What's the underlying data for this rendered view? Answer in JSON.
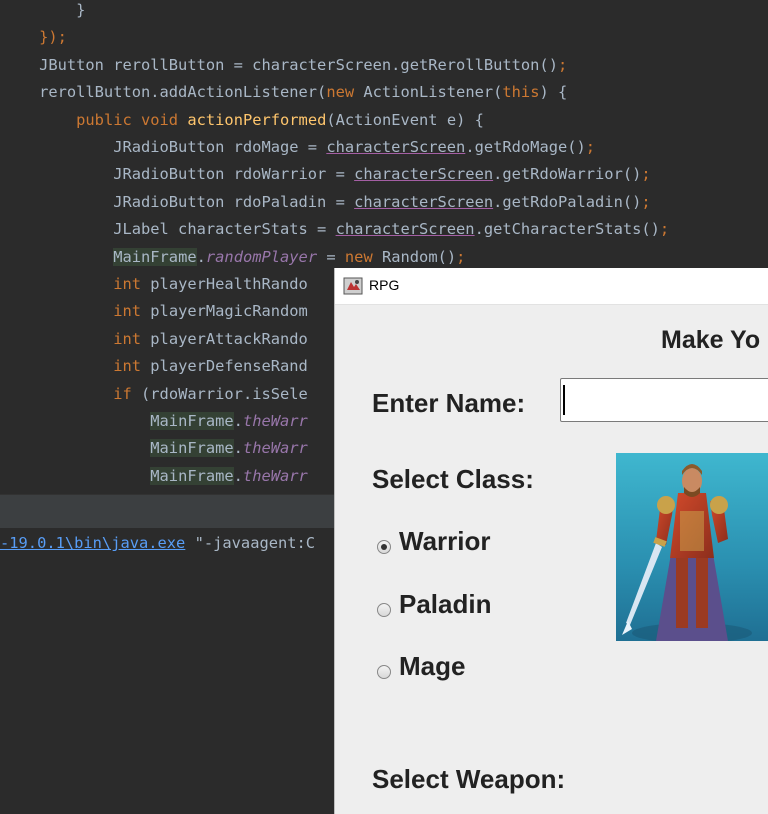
{
  "editor": {
    "lines": [
      {
        "parts": [
          {
            "t": "        }",
            "c": ""
          }
        ]
      },
      {
        "parts": [
          {
            "t": "    });",
            "c": "kw-semi"
          }
        ]
      },
      {
        "parts": [
          {
            "t": "    JButton rerollButton = characterScreen.getRerollButton()",
            "c": ""
          },
          {
            "t": ";",
            "c": "kw"
          }
        ]
      },
      {
        "parts": [
          {
            "t": "    rerollButton.addActionListener(",
            "c": ""
          },
          {
            "t": "new",
            "c": "kw"
          },
          {
            "t": " ActionListener(",
            "c": ""
          },
          {
            "t": "this",
            "c": "kw"
          },
          {
            "t": ") {",
            "c": ""
          }
        ]
      },
      {
        "parts": [
          {
            "t": "        ",
            "c": ""
          },
          {
            "t": "public void",
            "c": "kw"
          },
          {
            "t": " ",
            "c": ""
          },
          {
            "t": "actionPerformed",
            "c": "fn"
          },
          {
            "t": "(ActionEvent e) {",
            "c": ""
          }
        ]
      },
      {
        "parts": [
          {
            "t": "            JRadioButton rdoMage = ",
            "c": ""
          },
          {
            "t": "characterScreen",
            "c": "ul"
          },
          {
            "t": ".getRdoMage()",
            "c": ""
          },
          {
            "t": ";",
            "c": "kw"
          }
        ]
      },
      {
        "parts": [
          {
            "t": "            JRadioButton rdoWarrior = ",
            "c": ""
          },
          {
            "t": "characterScreen",
            "c": "ul"
          },
          {
            "t": ".getRdoWarrior()",
            "c": ""
          },
          {
            "t": ";",
            "c": "kw"
          }
        ]
      },
      {
        "parts": [
          {
            "t": "            JRadioButton rdoPaladin = ",
            "c": ""
          },
          {
            "t": "characterScreen",
            "c": "ul"
          },
          {
            "t": ".getRdoPaladin()",
            "c": ""
          },
          {
            "t": ";",
            "c": "kw"
          }
        ]
      },
      {
        "parts": [
          {
            "t": "            JLabel characterStats = ",
            "c": ""
          },
          {
            "t": "characterScreen",
            "c": "ul"
          },
          {
            "t": ".getCharacterStats()",
            "c": ""
          },
          {
            "t": ";",
            "c": "kw"
          }
        ]
      },
      {
        "parts": [
          {
            "t": "            ",
            "c": ""
          },
          {
            "t": "MainFrame",
            "c": "hl"
          },
          {
            "t": ".",
            "c": ""
          },
          {
            "t": "randomPlayer",
            "c": "fld"
          },
          {
            "t": " = ",
            "c": ""
          },
          {
            "t": "new",
            "c": "kw"
          },
          {
            "t": " Random()",
            "c": ""
          },
          {
            "t": ";",
            "c": "kw"
          }
        ]
      },
      {
        "parts": [
          {
            "t": "            ",
            "c": ""
          },
          {
            "t": "int",
            "c": "kw"
          },
          {
            "t": " playerHealthRando",
            "c": ""
          }
        ]
      },
      {
        "parts": [
          {
            "t": "            ",
            "c": ""
          },
          {
            "t": "int",
            "c": "kw"
          },
          {
            "t": " playerMagicRandom",
            "c": ""
          }
        ]
      },
      {
        "parts": [
          {
            "t": "            ",
            "c": ""
          },
          {
            "t": "int",
            "c": "kw"
          },
          {
            "t": " playerAttackRando",
            "c": ""
          }
        ]
      },
      {
        "parts": [
          {
            "t": "            ",
            "c": ""
          },
          {
            "t": "int",
            "c": "kw"
          },
          {
            "t": " playerDefenseRand",
            "c": ""
          }
        ]
      },
      {
        "parts": [
          {
            "t": "            ",
            "c": ""
          },
          {
            "t": "if",
            "c": "kw"
          },
          {
            "t": " (rdoWarrior.isSele",
            "c": ""
          }
        ]
      },
      {
        "parts": [
          {
            "t": "                ",
            "c": ""
          },
          {
            "t": "MainFrame",
            "c": "hl"
          },
          {
            "t": ".",
            "c": ""
          },
          {
            "t": "theWarr",
            "c": "fld"
          }
        ]
      },
      {
        "parts": [
          {
            "t": "                ",
            "c": ""
          },
          {
            "t": "MainFrame",
            "c": "hl"
          },
          {
            "t": ".",
            "c": ""
          },
          {
            "t": "theWarr",
            "c": "fld"
          }
        ]
      },
      {
        "parts": [
          {
            "t": "                ",
            "c": ""
          },
          {
            "t": "MainFrame",
            "c": "hl"
          },
          {
            "t": ".",
            "c": ""
          },
          {
            "t": "theWarr",
            "c": "fld"
          }
        ]
      }
    ]
  },
  "console": {
    "path_text": "-19.0.1\\bin\\java.exe",
    "args_text": " \"-javaagent:C"
  },
  "rpg_window": {
    "title": "RPG",
    "heading": "Make Yo",
    "name_label": "Enter Name:",
    "name_value": "",
    "class_label": "Select Class:",
    "classes": [
      {
        "label": "Warrior",
        "selected": true
      },
      {
        "label": "Paladin",
        "selected": false
      },
      {
        "label": "Mage",
        "selected": false
      }
    ],
    "weapon_label": "Select Weapon:",
    "portrait": "warrior-portrait"
  }
}
